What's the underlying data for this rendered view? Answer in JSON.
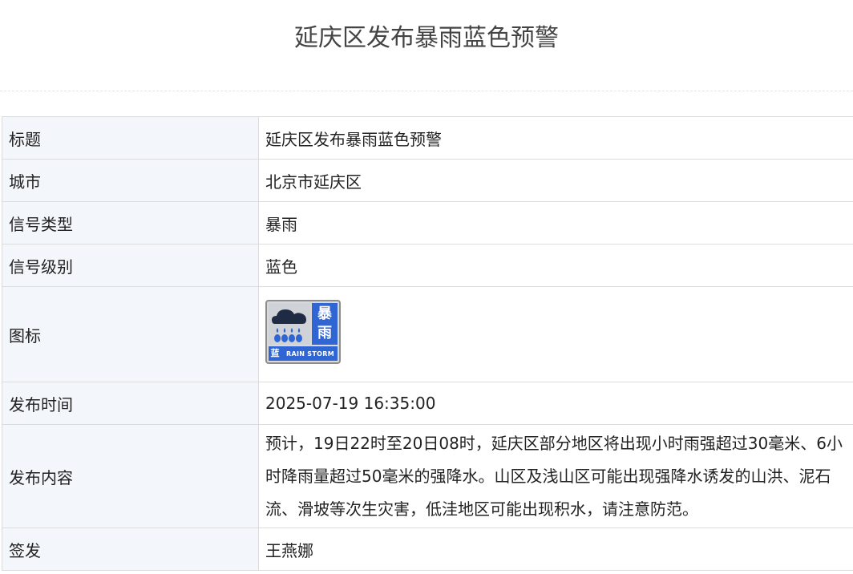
{
  "page": {
    "title": "延庆区发布暴雨蓝色预警"
  },
  "rows": [
    {
      "label": "标题",
      "value": "延庆区发布暴雨蓝色预警"
    },
    {
      "label": "城市",
      "value": "北京市延庆区"
    },
    {
      "label": "信号类型",
      "value": "暴雨"
    },
    {
      "label": "信号级别",
      "value": "蓝色"
    },
    {
      "label": "图标",
      "value": ""
    },
    {
      "label": "发布时间",
      "value": "2025-07-19 16:35:00"
    },
    {
      "label": "发布内容",
      "value": "预计，19日22时至20日08时，延庆区部分地区将出现小时雨强超过30毫米、6小时降雨量超过50毫米的强降水。山区及浅山区可能出现强降水诱发的山洪、泥石流、滑坡等次生灾害，低洼地区可能出现积水，请注意防范。"
    },
    {
      "label": "签发",
      "value": "王燕娜"
    }
  ],
  "icon": {
    "name": "rainstorm-blue-warning-icon",
    "word_top": "暴",
    "word_bottom": "雨",
    "level_char": "蓝",
    "english": "RAIN STORM",
    "colors": {
      "accent_blue": "#2f66d4",
      "frame_gray": "#8d8d8d",
      "cloud_gray": "#cfd3d8"
    }
  },
  "colors": {
    "label_bg": "#f3f6fb",
    "border": "#dcdcdc",
    "title_text": "#444444"
  }
}
